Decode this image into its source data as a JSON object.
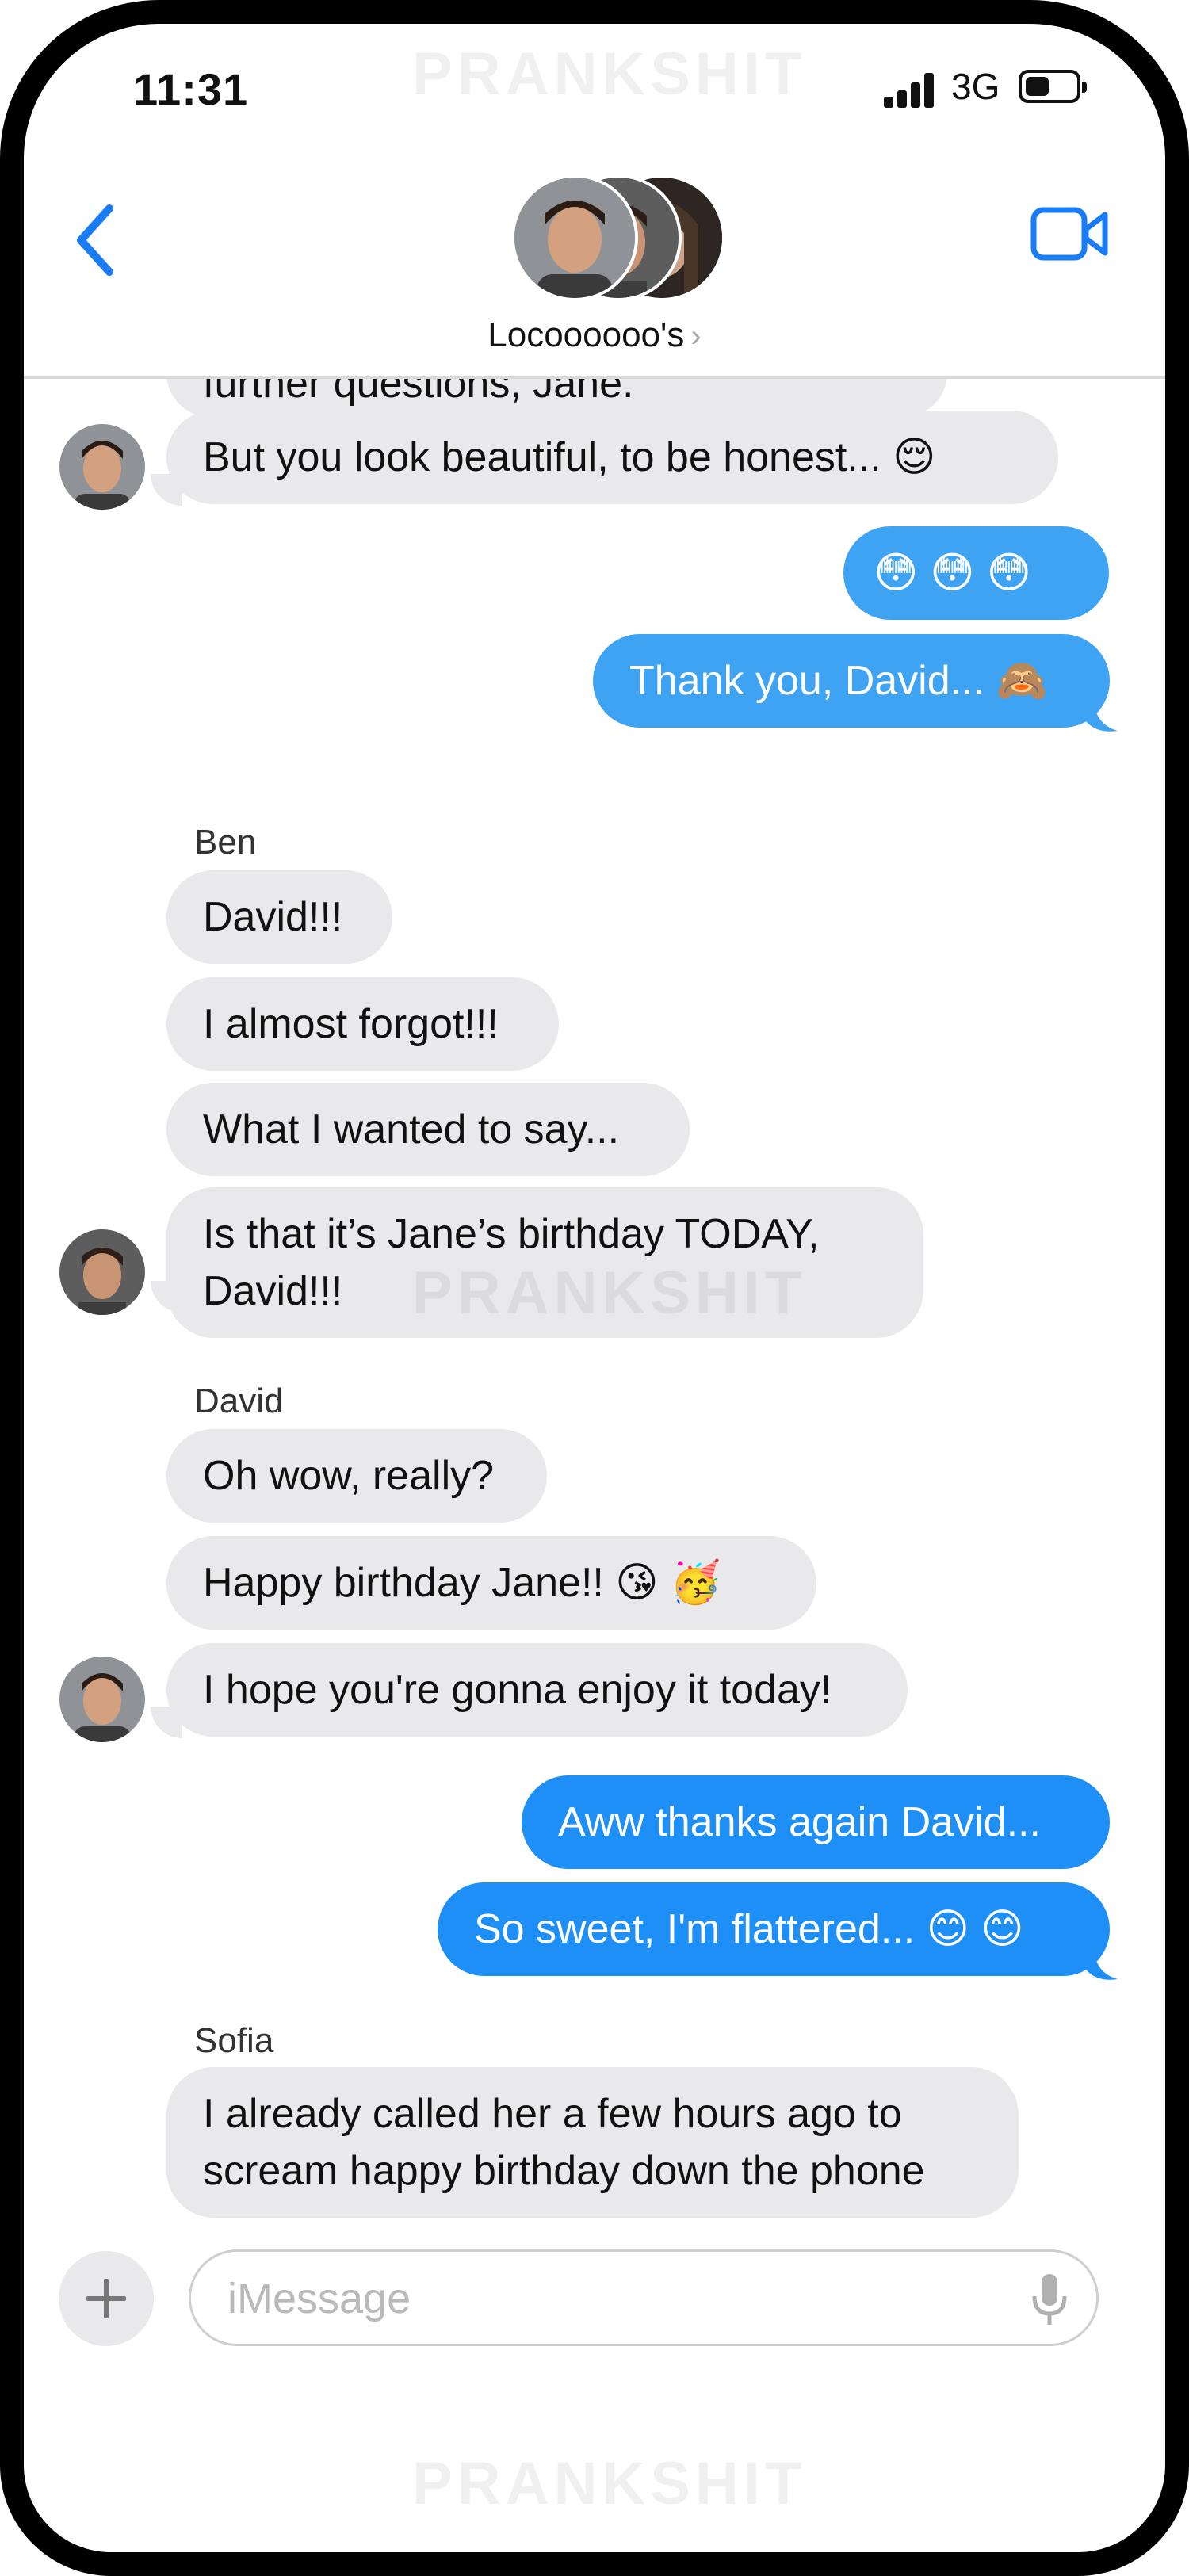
{
  "status_bar": {
    "time": "11:31",
    "network": "3G"
  },
  "watermark": "PRANKSHIT",
  "header": {
    "title": "Locoooooo's",
    "chevron": "›"
  },
  "messages": {
    "cutoff_text": "further questions, Jane.",
    "m1": "But you look beautiful, to be honest... 😌",
    "m2": "😳 😳 😳",
    "m3": "Thank you, David... 🙈",
    "sender_ben": "Ben",
    "m4": "David!!!",
    "m5": "I almost forgot!!!",
    "m6": "What I wanted to say...",
    "m7_line1": "Is that it’s Jane’s birthday TODAY,",
    "m7_line2": "David!!!",
    "sender_david": "David",
    "m8": "Oh wow, really?",
    "m9": "Happy birthday Jane!! 😘 🥳",
    "m10": "I hope you're gonna enjoy it today!",
    "m11": "Aww thanks again David...",
    "m12": "So sweet, I'm flattered... 😊 😊",
    "sender_sofia": "Sofia",
    "m13_line1": "I already called her a few hours ago to",
    "m13_line2": "scream happy birthday down the phone",
    "m14": "😆 😆"
  },
  "input": {
    "placeholder": "iMessage"
  },
  "colors": {
    "incoming": "#e9e9eb",
    "outgoing": "#3fa3f4",
    "outgoing_dark": "#1d8ff6",
    "accent": "#1a7cf5"
  },
  "icons": [
    "back-chevron-icon",
    "video-camera-icon",
    "plus-icon",
    "microphone-icon",
    "signal-icon",
    "battery-icon"
  ]
}
